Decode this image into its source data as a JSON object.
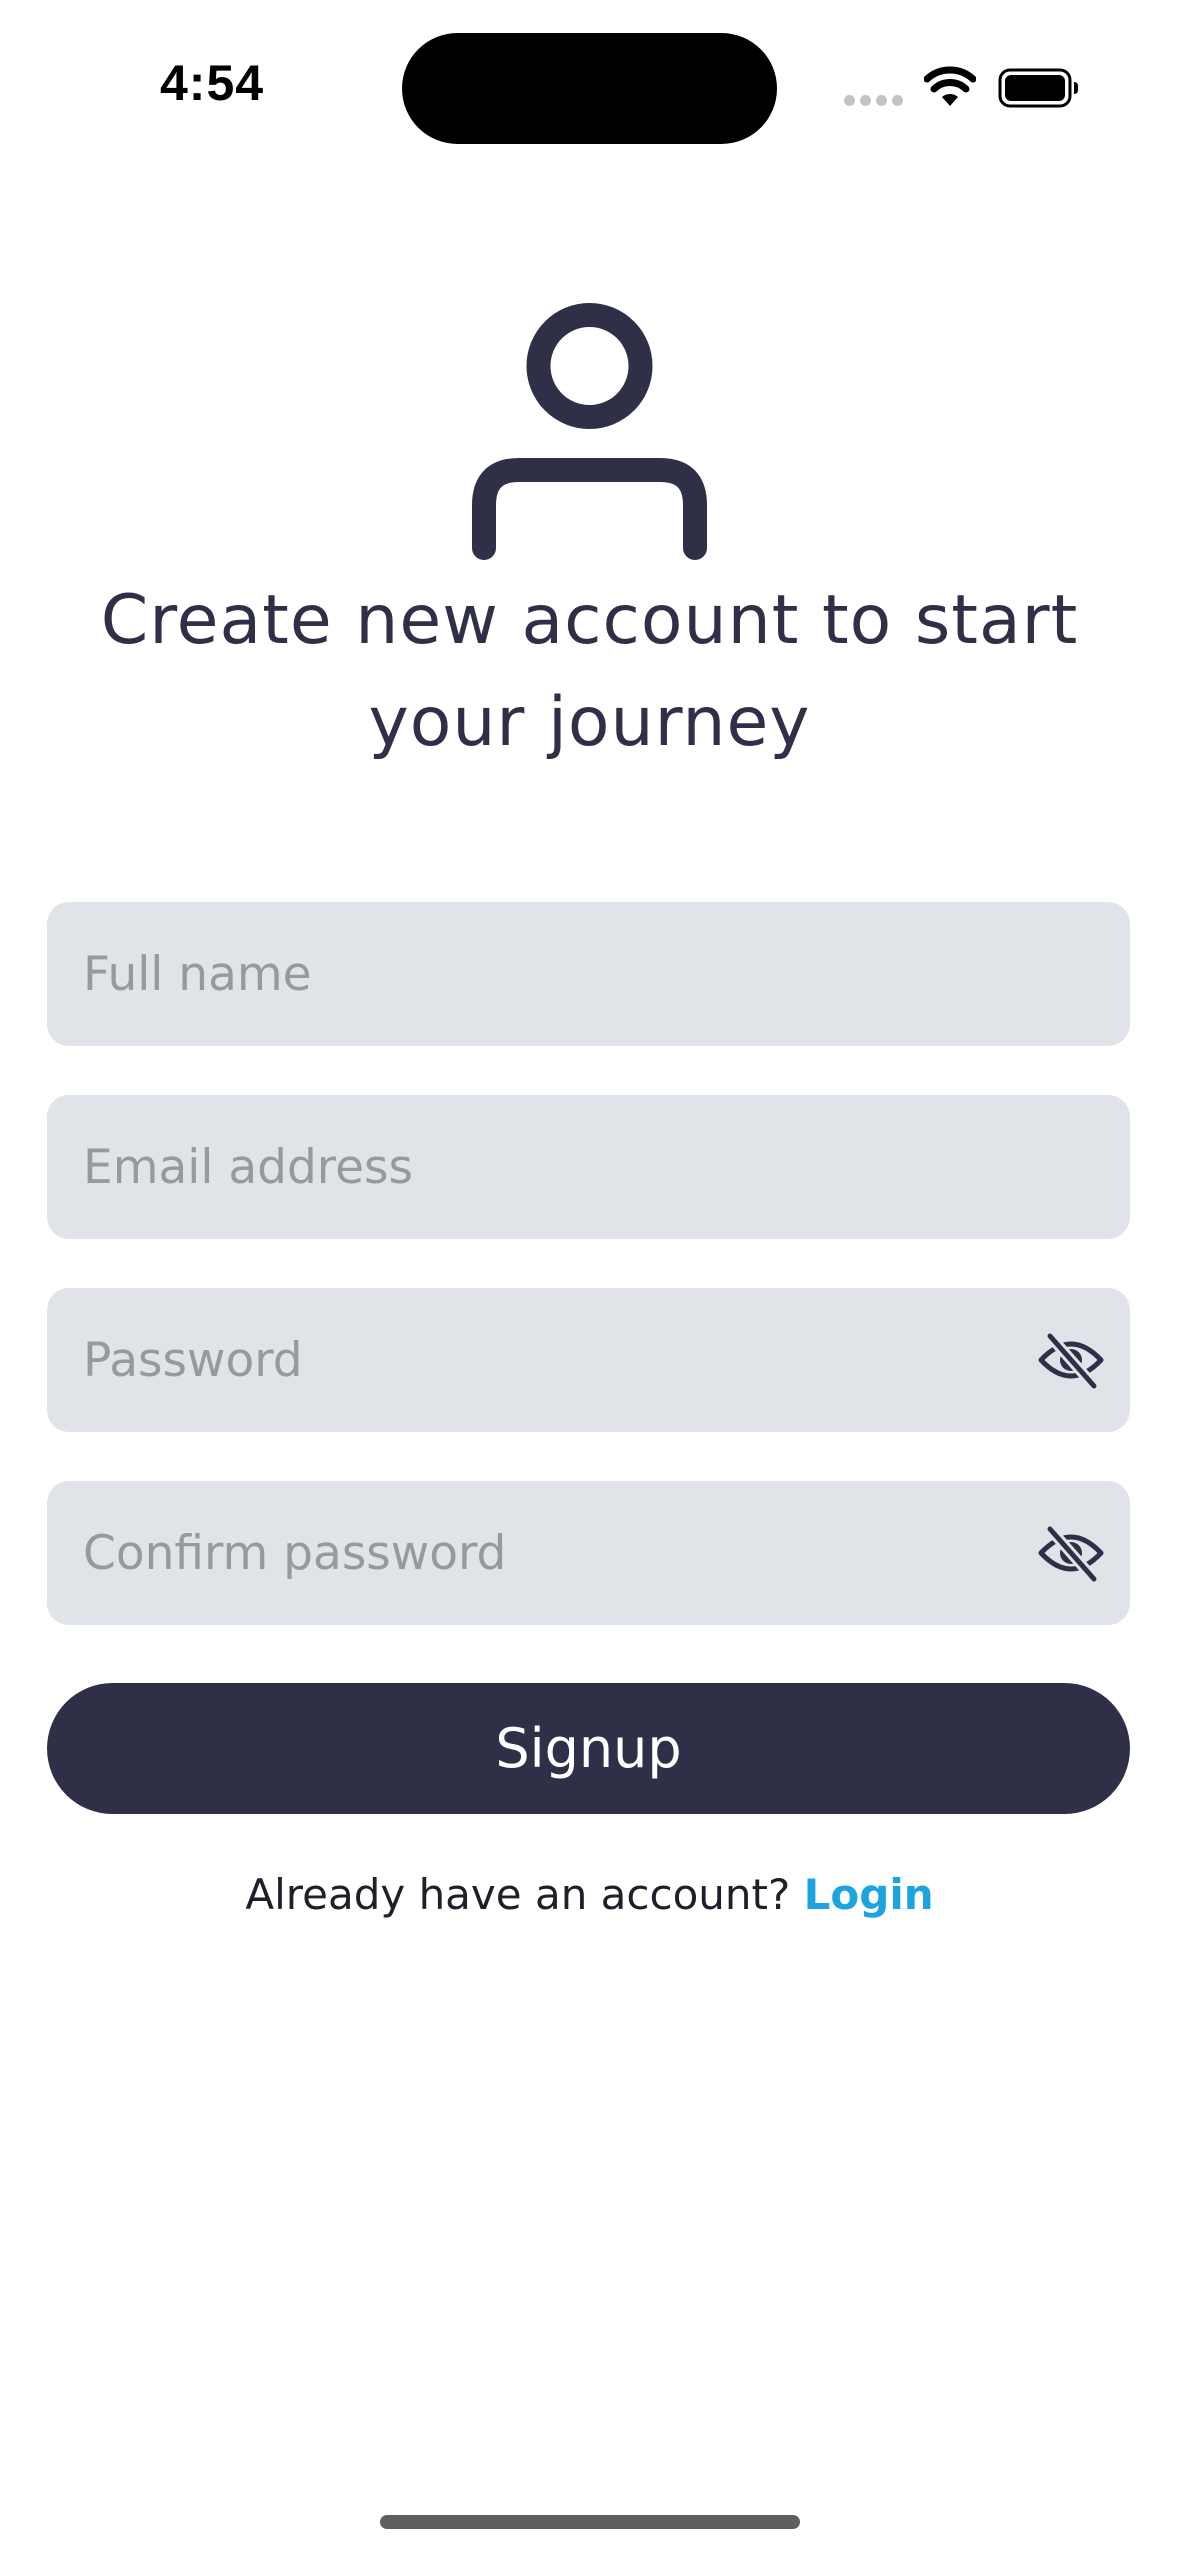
{
  "status_bar": {
    "time": "4:54"
  },
  "header": {
    "icon": "user-icon",
    "title": "Create new account to start your journey"
  },
  "form": {
    "full_name": {
      "placeholder": "Full name",
      "value": ""
    },
    "email": {
      "placeholder": "Email address",
      "value": ""
    },
    "password": {
      "placeholder": "Password",
      "value": "",
      "toggle_icon": "eye-off-icon"
    },
    "confirm_password": {
      "placeholder": "Confirm password",
      "value": "",
      "toggle_icon": "eye-off-icon"
    },
    "submit_label": "Signup"
  },
  "footer": {
    "prompt": "Already have an account? ",
    "link_label": "Login"
  },
  "colors": {
    "primary": "#2f3048",
    "field_background": "#e0e4e8",
    "placeholder": "#96999e",
    "link": "#1ca4e0",
    "background": "#ffffff"
  }
}
